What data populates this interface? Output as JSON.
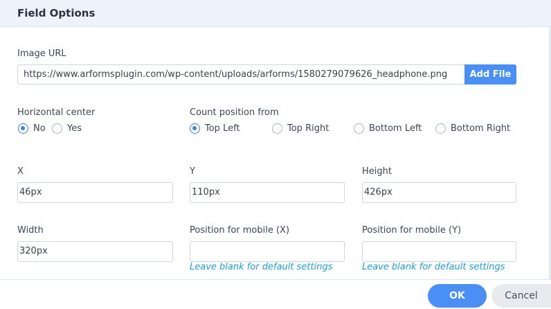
{
  "header": {
    "title": "Field Options"
  },
  "image_url": {
    "label": "Image URL",
    "value": "https://www.arformsplugin.com/wp-content/uploads/arforms/1580279079626_headphone.png",
    "add_file_label": "Add File"
  },
  "horizontal_center": {
    "label": "Horizontal center",
    "options": [
      {
        "label": "No",
        "checked": true
      },
      {
        "label": "Yes",
        "checked": false
      }
    ]
  },
  "count_position": {
    "label": "Count position from",
    "options": [
      {
        "label": "Top Left",
        "checked": true
      },
      {
        "label": "Top Right",
        "checked": false
      },
      {
        "label": "Bottom Left",
        "checked": false
      },
      {
        "label": "Bottom Right",
        "checked": false
      }
    ]
  },
  "x": {
    "label": "X",
    "value": "46px"
  },
  "y": {
    "label": "Y",
    "value": "110px"
  },
  "height": {
    "label": "Height",
    "value": "426px"
  },
  "width": {
    "label": "Width",
    "value": "320px"
  },
  "mobile_x": {
    "label": "Position for mobile (X)",
    "value": "",
    "hint": "Leave blank for default settings"
  },
  "mobile_y": {
    "label": "Position for mobile (Y)",
    "value": "",
    "hint": "Leave blank for default settings"
  },
  "footer": {
    "ok_label": "OK",
    "cancel_label": "Cancel"
  },
  "colors": {
    "accent": "#4a8ff5",
    "radio_checked": "#3f7fe8",
    "hint": "#1ea0d8",
    "header_bg": "#eef3fb"
  }
}
